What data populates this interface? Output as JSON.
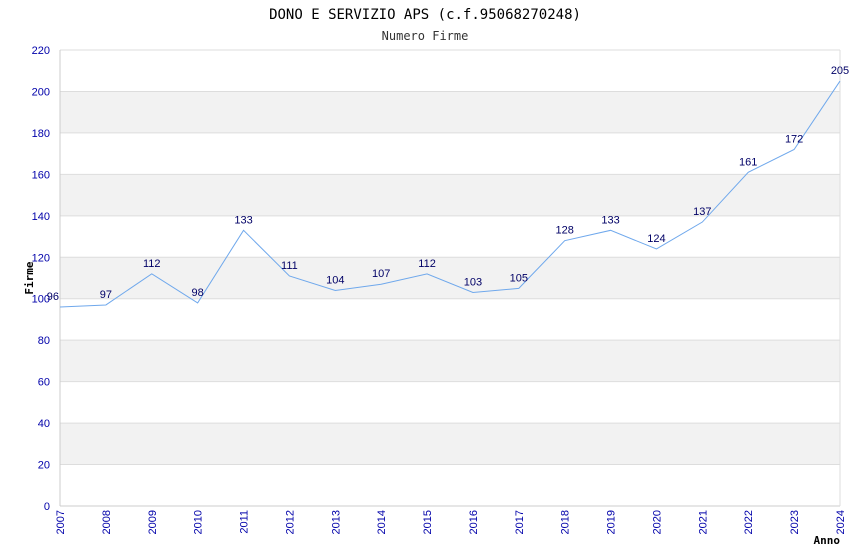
{
  "colors": {
    "line": "#6fa8ec",
    "band": "#f2f2f2",
    "grid": "#dddddd",
    "axis": "#cccccc",
    "tick_text": "#0000aa",
    "data_label": "#000066"
  },
  "chart_data": {
    "type": "line",
    "title": "DONO E SERVIZIO APS (c.f.95068270248)",
    "subtitle": "Numero Firme",
    "xlabel": "Anno",
    "ylabel": "Firme",
    "ylim": [
      0,
      220
    ],
    "yticks": [
      0,
      20,
      40,
      60,
      80,
      100,
      120,
      140,
      160,
      180,
      200,
      220
    ],
    "grid": true,
    "legend": "none",
    "x": [
      "2007",
      "2008",
      "2009",
      "2010",
      "2011",
      "2012",
      "2013",
      "2014",
      "2015",
      "2016",
      "2017",
      "2018",
      "2019",
      "2020",
      "2021",
      "2022",
      "2023",
      "2024"
    ],
    "series": [
      {
        "values": [
          96,
          97,
          112,
          98,
          133,
          111,
          104,
          107,
          112,
          103,
          105,
          128,
          133,
          124,
          137,
          161,
          172,
          205
        ]
      }
    ]
  }
}
